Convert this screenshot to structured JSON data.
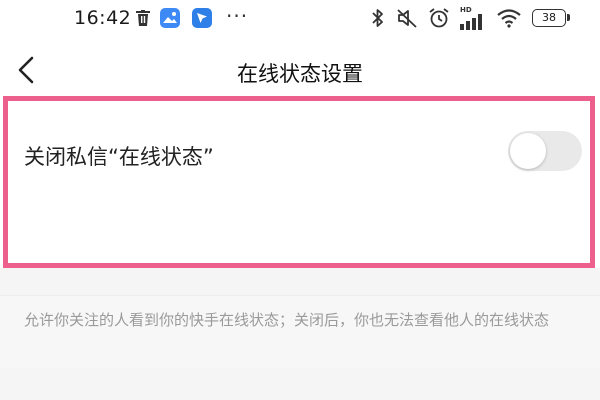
{
  "status_bar": {
    "time": "16:42",
    "dots": "···",
    "hd": "HD",
    "battery": "38",
    "icons": [
      "trash-icon",
      "gallery-app-icon",
      "location-arrow-icon",
      "bluetooth-icon",
      "mute-icon",
      "alarm-icon",
      "signal-icon",
      "wifi-icon",
      "battery-icon"
    ]
  },
  "nav": {
    "title": "在线状态设置",
    "back_icon": "chevron-left-icon"
  },
  "setting": {
    "label": "关闭私信“在线状态”",
    "toggle_on": false,
    "description": "允许你关注的人看到你的快手在线状态；关闭后，你也无法查看他人的在线状态"
  },
  "colors": {
    "highlight": "#ed5f8d",
    "background": "#f5f5f5",
    "toggle_off": "#e9e9e9",
    "description_text": "#9a9a9a"
  }
}
